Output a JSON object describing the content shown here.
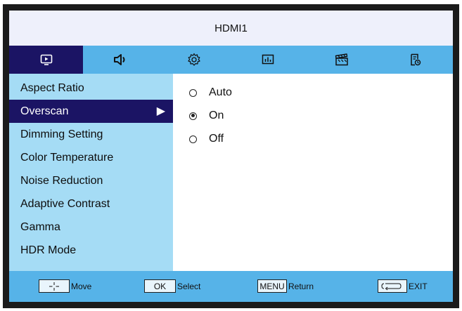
{
  "header": {
    "title": "HDMI1"
  },
  "tabs": [
    {
      "icon": "picture-icon",
      "active": true
    },
    {
      "icon": "speaker-icon",
      "active": false
    },
    {
      "icon": "gear-icon",
      "active": false
    },
    {
      "icon": "chart-icon",
      "active": false
    },
    {
      "icon": "clapperboard-icon",
      "active": false
    },
    {
      "icon": "document-clock-icon",
      "active": false
    }
  ],
  "menu": {
    "items": [
      {
        "label": "Aspect Ratio"
      },
      {
        "label": "Overscan",
        "selected": true,
        "arrow": "▶"
      },
      {
        "label": "Dimming Setting"
      },
      {
        "label": "Color Temperature"
      },
      {
        "label": "Noise Reduction"
      },
      {
        "label": "Adaptive Contrast"
      },
      {
        "label": "Gamma"
      },
      {
        "label": "HDR Mode"
      }
    ]
  },
  "options": [
    {
      "label": "Auto",
      "checked": false
    },
    {
      "label": "On",
      "checked": true
    },
    {
      "label": "Off",
      "checked": false
    }
  ],
  "footer": {
    "move": {
      "key_icon": "dpad-icon",
      "label": "Move"
    },
    "select": {
      "key": "OK",
      "label": "Select"
    },
    "return": {
      "key": "MENU",
      "label": "Return"
    },
    "exit": {
      "key_icon": "return-arrows-icon",
      "label": "EXIT"
    }
  },
  "colors": {
    "accent_dark": "#1b1464",
    "tab_bar": "#56b3e8",
    "sidebar": "#a5dcf5",
    "title_bar": "#eef0fb"
  }
}
